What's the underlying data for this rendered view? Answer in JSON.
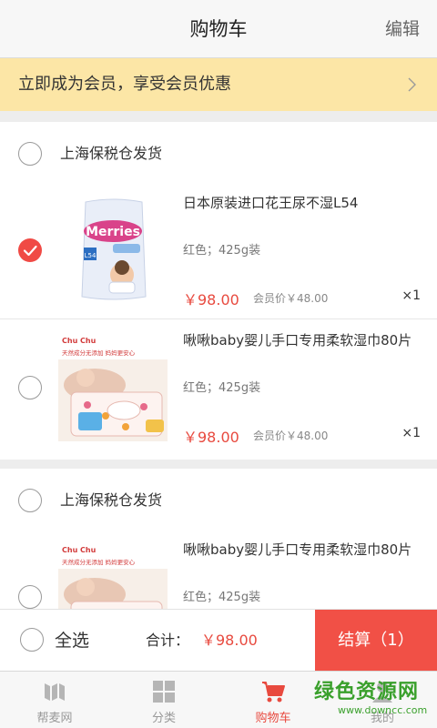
{
  "header": {
    "title": "购物车",
    "edit_label": "编辑"
  },
  "member_banner": {
    "text": "立即成为会员，享受会员优惠"
  },
  "groups": [
    {
      "store": "上海保税仓发货",
      "items": [
        {
          "name": "日本原装进口花王尿不湿L54",
          "spec": "红色；425g装",
          "price": "￥98.00",
          "member_price": "会员价￥48.00",
          "qty": "×1",
          "checked": true
        },
        {
          "name": "啾啾baby婴儿手口专用柔软湿巾80片",
          "spec": "红色；425g装",
          "price": "￥98.00",
          "member_price": "会员价￥48.00",
          "qty": "×1",
          "checked": false
        }
      ]
    },
    {
      "store": "上海保税仓发货",
      "items": [
        {
          "name": "啾啾baby婴儿手口专用柔软湿巾80片",
          "spec": "红色；425g装"
        }
      ]
    }
  ],
  "diaper_pack": {
    "brand": "Merries",
    "size": "L54"
  },
  "wipes_pack": {
    "brand": "Chu Chu",
    "label": "天然成分无添加 妈妈更安心"
  },
  "footer": {
    "select_all": "全选",
    "total_label": "合计：",
    "total_value": "￥98.00",
    "checkout_label": "结算（1）"
  },
  "tabs": [
    {
      "label": "帮麦网",
      "icon": "brand-icon"
    },
    {
      "label": "分类",
      "icon": "grid-icon"
    },
    {
      "label": "购物车",
      "icon": "cart-icon",
      "active": true
    },
    {
      "label": "我的",
      "icon": "user-icon"
    }
  ],
  "watermark": {
    "title": "绿色资源网",
    "url": "www.downcc.com"
  },
  "colors": {
    "accent": "#f15046",
    "price": "#e84a3f",
    "banner": "#fce6a6",
    "watermark": "#3aa02c"
  }
}
